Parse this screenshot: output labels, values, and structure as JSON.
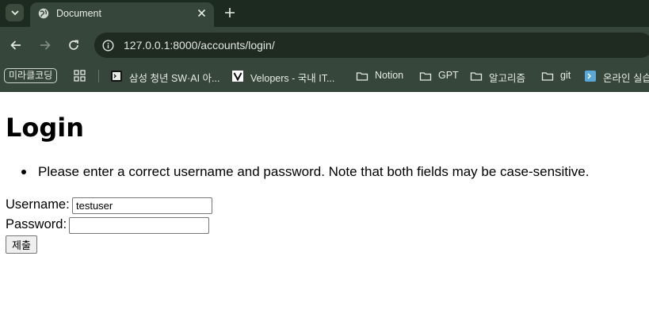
{
  "tab": {
    "title": "Document",
    "favicon": "globe-icon"
  },
  "omnibox": {
    "url": "127.0.0.1:8000/accounts/login/"
  },
  "bookmarks": {
    "pill": "미라클코딩",
    "items": [
      {
        "label": "삼성 청년 SW·AI 아...",
        "icon": "terminal-icon"
      },
      {
        "label": "Velopers - 국내 IT...",
        "icon": "v-logo-icon"
      },
      {
        "label": "Notion",
        "icon": "folder-icon"
      },
      {
        "label": "GPT",
        "icon": "folder-icon"
      },
      {
        "label": "알고리즘",
        "icon": "folder-icon"
      },
      {
        "label": "git",
        "icon": "folder-icon"
      },
      {
        "label": "온라인 실습",
        "icon": "terminal-icon"
      }
    ]
  },
  "page": {
    "title": "Login",
    "error": "Please enter a correct username and password. Note that both fields may be case-sensitive.",
    "username_label": "Username:",
    "username_value": "testuser",
    "password_label": "Password:",
    "password_value": "",
    "submit_label": "제출"
  }
}
